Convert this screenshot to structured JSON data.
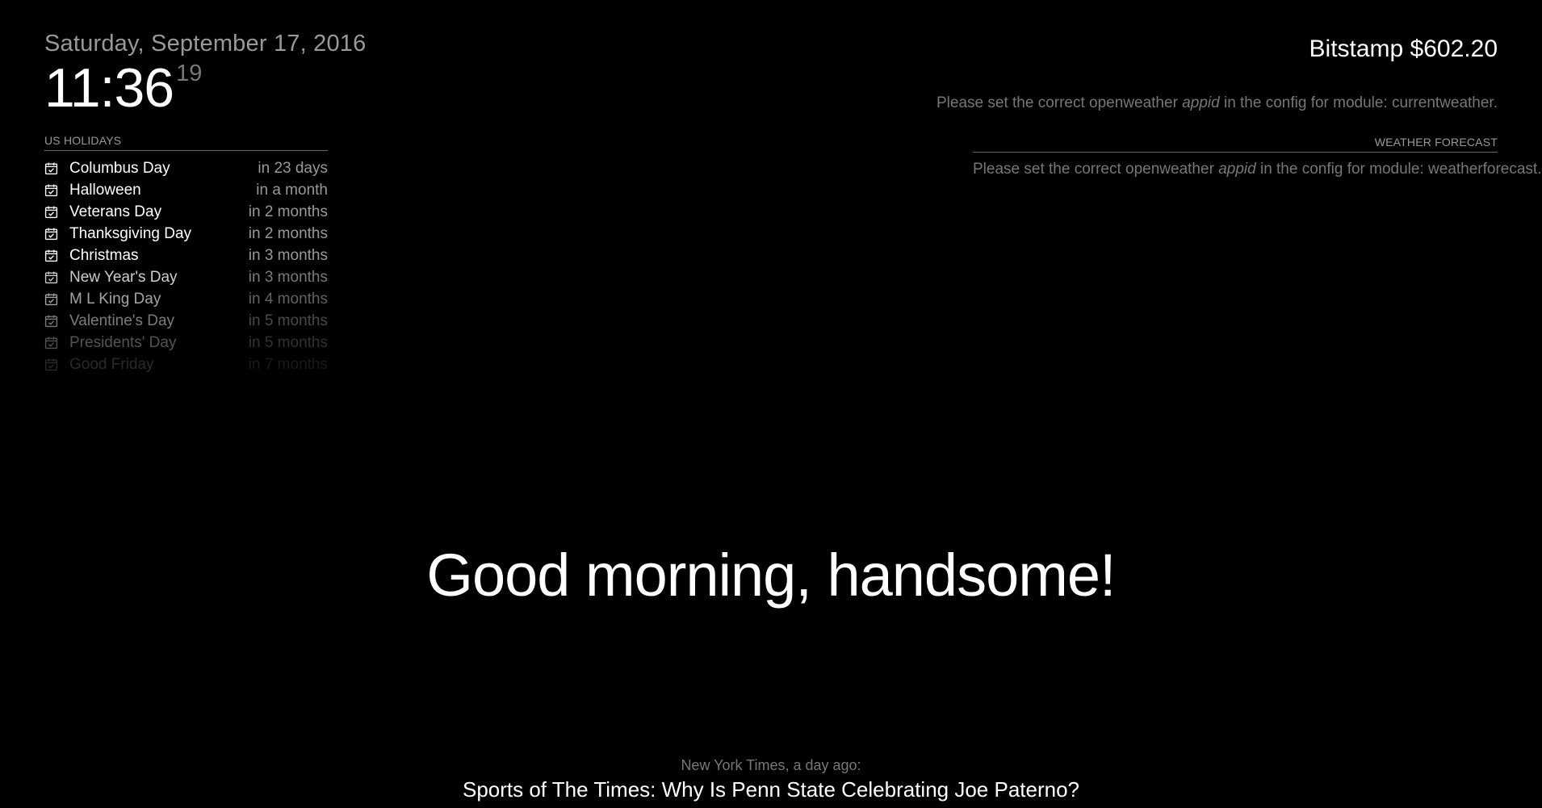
{
  "clock": {
    "date": "Saturday, September 17, 2016",
    "hours_minutes": "11:36",
    "seconds": "19"
  },
  "calendar": {
    "header": "US HOLIDAYS",
    "icon": "calendar-check-icon",
    "events": [
      {
        "title": "Columbus Day",
        "when": "in 23 days",
        "opacity": 1.0
      },
      {
        "title": "Halloween",
        "when": "in a month",
        "opacity": 1.0
      },
      {
        "title": "Veterans Day",
        "when": "in 2 months",
        "opacity": 1.0
      },
      {
        "title": "Thanksgiving Day",
        "when": "in 2 months",
        "opacity": 1.0
      },
      {
        "title": "Christmas",
        "when": "in 3 months",
        "opacity": 1.0
      },
      {
        "title": "New Year's Day",
        "when": "in 3 months",
        "opacity": 0.8
      },
      {
        "title": "M L King Day",
        "when": "in 4 months",
        "opacity": 0.64
      },
      {
        "title": "Valentine's Day",
        "when": "in 5 months",
        "opacity": 0.48
      },
      {
        "title": "Presidents' Day",
        "when": "in 5 months",
        "opacity": 0.32
      },
      {
        "title": "Good Friday",
        "when": "in 7 months",
        "opacity": 0.16
      }
    ]
  },
  "ticker": {
    "text": "Bitstamp $602.20"
  },
  "current_weather": {
    "msg_prefix": "Please set the correct openweather ",
    "msg_key": "appid",
    "msg_suffix": " in the config for module: currentweather."
  },
  "weather_forecast": {
    "header": "WEATHER FORECAST",
    "msg_prefix": "Please set the correct openweather ",
    "msg_key": "appid",
    "msg_suffix": " in the config for module: weatherforecast."
  },
  "compliment": {
    "text": "Good morning, handsome!"
  },
  "news": {
    "source": "New York Times, a day ago:",
    "headline": "Sports of The Times: Why Is Penn State Celebrating Joe Paterno?"
  },
  "colors": {
    "background": "#000000",
    "bright": "#ffffff",
    "normal": "#999999",
    "dimmed": "#777777"
  }
}
